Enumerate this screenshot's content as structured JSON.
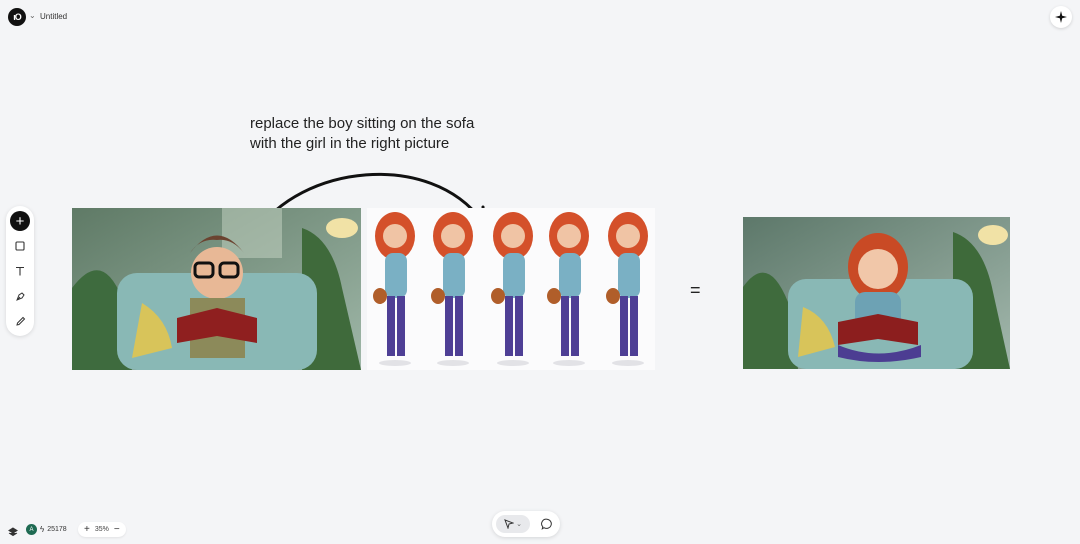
{
  "header": {
    "logo_text": "ιO",
    "document_title": "Untitled"
  },
  "icons": {
    "logo": "logo-icon",
    "title_dropdown": "chevron-down-icon",
    "assistant": "sparkle-icon",
    "add": "plus-icon",
    "rectangle": "square-icon",
    "text": "text-icon",
    "pen": "pen-icon",
    "pencil": "pencil-icon",
    "layers": "layers-icon",
    "credits": "bolt-icon",
    "select": "cursor-arrow-icon",
    "comment": "comment-icon"
  },
  "canvas": {
    "annotation_line1": "replace the boy sitting on the sofa",
    "annotation_line2": "with the girl in the right picture",
    "equals_sign": "=",
    "images": [
      {
        "name": "boy-on-sofa-image",
        "description_visible": false
      },
      {
        "name": "girl-character-sheet-image",
        "description_visible": false
      },
      {
        "name": "girl-on-sofa-result-image",
        "description_visible": false
      }
    ]
  },
  "footer": {
    "avatar_initial": "A",
    "credits": "25178",
    "zoom_minus": "−",
    "zoom_plus": "+",
    "zoom_level": "35%"
  },
  "colors": {
    "canvas_bg": "#f4f5f7",
    "accent_dark": "#111111",
    "avatar_green": "#1e6a52"
  }
}
